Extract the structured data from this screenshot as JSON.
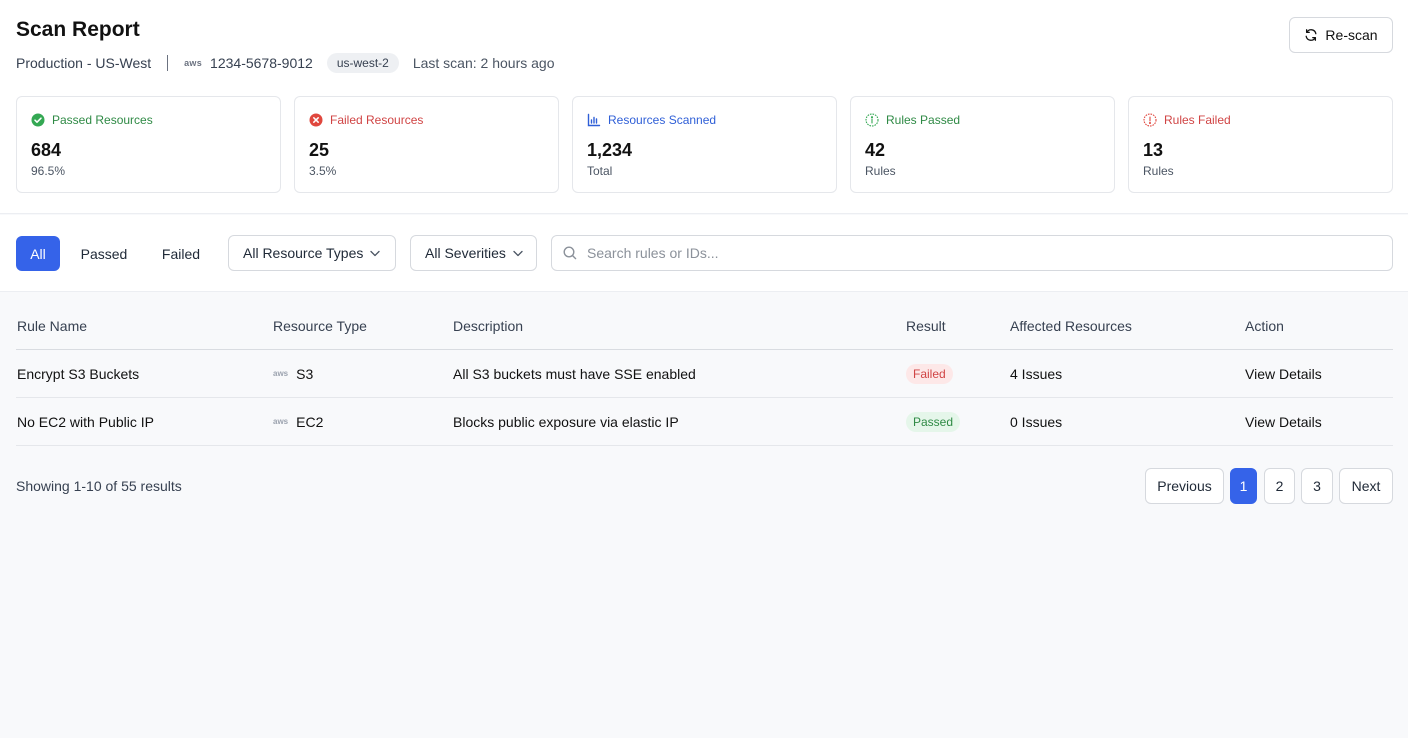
{
  "header": {
    "title": "Scan Report",
    "environment": "Production - US-West",
    "provider_badge": "aws",
    "account_id": "1234-5678-9012",
    "region": "us-west-2",
    "last_scan": "Last scan: 2 hours ago",
    "rescan_label": "Re-scan"
  },
  "stats": [
    {
      "label": "Passed Resources",
      "value": "684",
      "sub": "96.5%",
      "color": "#2f8a45",
      "icon": "check-circle-icon"
    },
    {
      "label": "Failed Resources",
      "value": "25",
      "sub": "3.5%",
      "color": "#d04444",
      "icon": "x-circle-icon"
    },
    {
      "label": "Resources Scanned",
      "value": "1,234",
      "sub": "Total",
      "color": "#2f5fd7",
      "icon": "bar-chart-icon"
    },
    {
      "label": "Rules Passed",
      "value": "42",
      "sub": "Rules",
      "color": "#2f8a45",
      "icon": "info-circle-icon"
    },
    {
      "label": "Rules Failed",
      "value": "13",
      "sub": "Rules",
      "color": "#d04444",
      "icon": "alert-circle-icon"
    }
  ],
  "filters": {
    "tabs": [
      "All",
      "Passed",
      "Failed"
    ],
    "active_tab": "All",
    "resource_type": "All Resource Types",
    "severity": "All Severities",
    "search_placeholder": "Search rules or IDs..."
  },
  "table": {
    "columns": [
      "Rule Name",
      "Resource Type",
      "Description",
      "Result",
      "Affected Resources",
      "Action"
    ],
    "rows": [
      {
        "rule": "Encrypt S3 Buckets",
        "provider": "aws",
        "type": "S3",
        "description": "All S3 buckets must have SSE enabled",
        "result": "Failed",
        "affected": "4 Issues",
        "action": "View Details"
      },
      {
        "rule": "No EC2 with Public IP",
        "provider": "aws",
        "type": "EC2",
        "description": "Blocks public exposure via elastic IP",
        "result": "Passed",
        "affected": "0 Issues",
        "action": "View Details"
      }
    ]
  },
  "pagination": {
    "summary": "Showing 1-10 of 55 results",
    "previous": "Previous",
    "pages": [
      "1",
      "2",
      "3"
    ],
    "current": "1",
    "next": "Next"
  },
  "colors": {
    "accent": "#3563e9",
    "success": "#2f8a45",
    "danger": "#d04444",
    "link": "#2f5fd7"
  }
}
